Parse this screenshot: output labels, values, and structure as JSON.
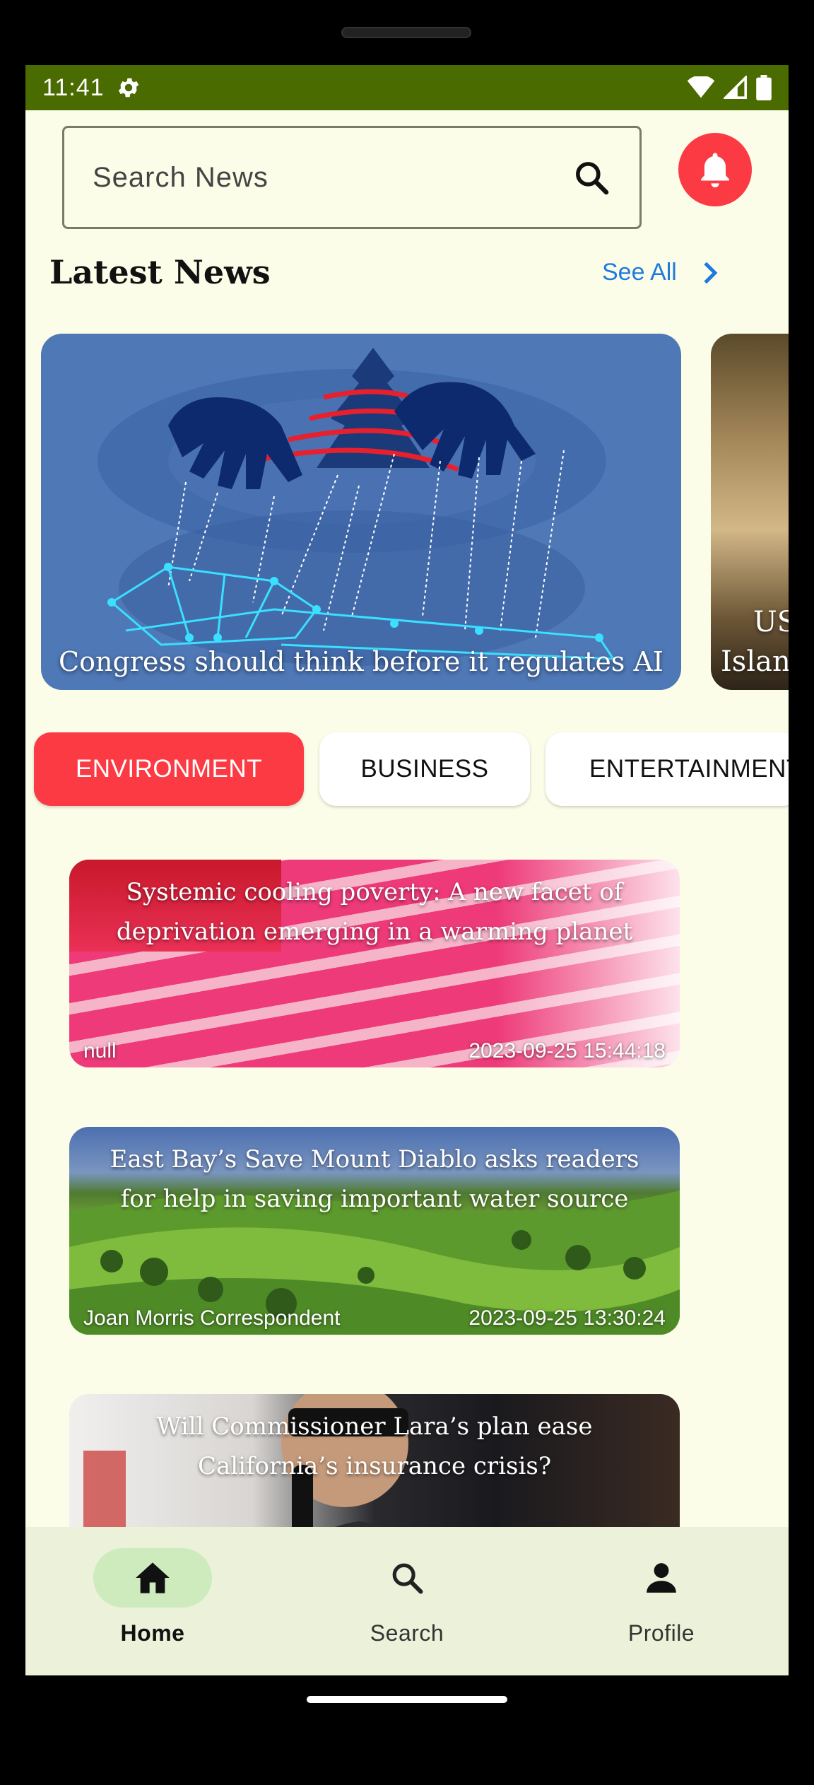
{
  "status_bar": {
    "time": "11:41"
  },
  "search": {
    "placeholder": "Search News"
  },
  "latest": {
    "title": "Latest News",
    "see_all": "See All"
  },
  "featured": [
    {
      "title": "Congress should think before it regulates AI"
    },
    {
      "title_line1": "US",
      "title_line2": "Islan"
    }
  ],
  "categories": [
    {
      "label": "ENVIRONMENT",
      "active": true
    },
    {
      "label": "BUSINESS",
      "active": false
    },
    {
      "label": "ENTERTAINMENT",
      "active": false
    }
  ],
  "news": [
    {
      "title": "Systemic cooling poverty: A new facet of deprivation emerging in a warming planet",
      "author": "null",
      "date": "2023-09-25 15:44:18"
    },
    {
      "title": "East Bay’s Save Mount Diablo asks readers for help in saving important water source",
      "author": "Joan Morris Correspondent",
      "date": "2023-09-25 13:30:24"
    },
    {
      "title": "Will Commissioner Lara’s plan ease California’s insurance crisis?",
      "author": "",
      "date": ""
    }
  ],
  "nav": [
    {
      "label": "Home",
      "icon": "home-icon",
      "active": true
    },
    {
      "label": "Search",
      "icon": "search-icon",
      "active": false
    },
    {
      "label": "Profile",
      "icon": "person-icon",
      "active": false
    }
  ],
  "colors": {
    "accent": "#fb3a43",
    "status_bar": "#4a6b00",
    "link": "#1f7ae0",
    "background": "#fbfde8"
  }
}
